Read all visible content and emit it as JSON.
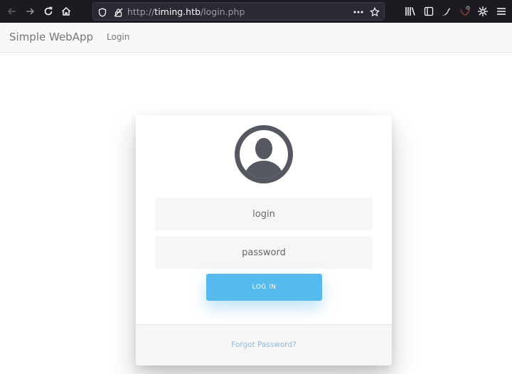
{
  "browser": {
    "url_protocol": "http://",
    "url_host": "timing.htb",
    "url_path": "/login.php",
    "icons": [
      "back-icon",
      "forward-icon",
      "reload-icon",
      "home-icon",
      "shield-icon",
      "no-lock-icon",
      "more-icon",
      "star-icon",
      "library-icon",
      "reader-icon",
      "extension-icon",
      "pocket-icon",
      "addon-icon"
    ],
    "theme_color": "#1c1b22"
  },
  "navbar": {
    "brand": "Simple WebApp",
    "links": [
      {
        "label": "Login"
      }
    ]
  },
  "login_form": {
    "avatar_icon": "user-avatar-icon",
    "login_placeholder": "login",
    "password_placeholder": "password",
    "submit_label": "LOG IN",
    "forgot_label": "Forgot Password?",
    "accent_color": "#56baed"
  }
}
